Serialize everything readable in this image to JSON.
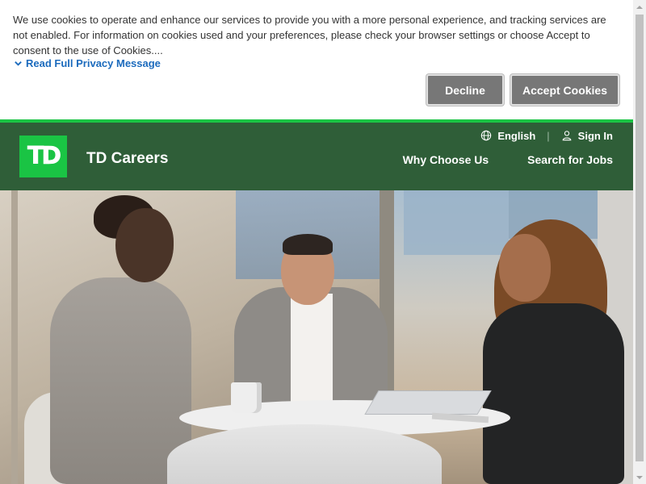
{
  "cookie_banner": {
    "message": "We use cookies to operate and enhance our services to provide you with a more personal experience, and tracking services are not enabled. For information on cookies used and your preferences, please check your browser settings or choose Accept to consent to the use of Cookies....",
    "read_more_label": "Read Full Privacy Message",
    "decline_label": "Decline",
    "accept_label": "Accept Cookies"
  },
  "header": {
    "logo_text": "TD",
    "brand_title": "TD Careers",
    "language_label": "English",
    "signin_label": "Sign In",
    "separator": "|",
    "nav": [
      {
        "label": "Why Choose Us"
      },
      {
        "label": "Search for Jobs"
      }
    ]
  },
  "colors": {
    "brand_green": "#1ac444",
    "header_green": "#2f5e38",
    "link_blue": "#1c6bbd",
    "button_gray": "#777777"
  },
  "icons": [
    "chevron-down-icon",
    "globe-icon",
    "user-icon",
    "scroll-up-arrow-icon",
    "scroll-down-arrow-icon"
  ]
}
